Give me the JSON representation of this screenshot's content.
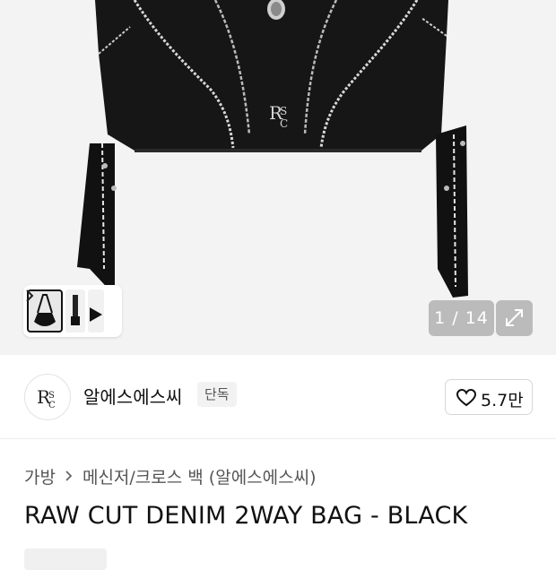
{
  "gallery": {
    "counter": "1 / 14",
    "icons": {
      "next": "chevron-right-icon",
      "expand": "expand-diagonal-icon"
    }
  },
  "brand": {
    "name": "알에스에스씨",
    "badge": "단독",
    "logo_text": "RSC",
    "like_count": "5.7만",
    "icons": {
      "like": "heart-outline-icon"
    }
  },
  "product": {
    "breadcrumb": [
      "가방",
      "메신저/크로스 백 (알에스에스씨)"
    ],
    "title": "RAW CUT DENIM 2WAY BAG - BLACK"
  },
  "colors": {
    "accent": "#111111",
    "background": "#f3f3f3",
    "divider": "#ececec"
  }
}
